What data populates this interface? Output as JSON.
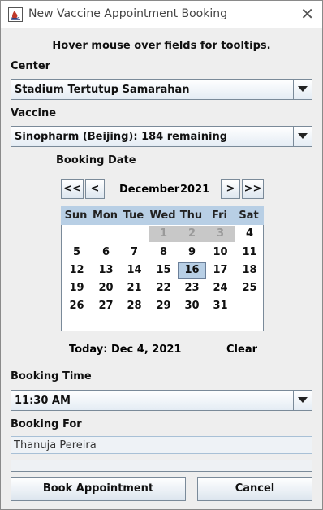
{
  "window": {
    "title": "New Vaccine Appointment Booking",
    "close_symbol": "✕"
  },
  "hint": "Hover mouse over fields for tooltips.",
  "center": {
    "label": "Center",
    "value": "Stadium Tertutup Samarahan"
  },
  "vaccine": {
    "label": "Vaccine",
    "value": "Sinopharm (Beijing): 184 remaining"
  },
  "booking_date": {
    "label": "Booking Date",
    "prev_year": "<<",
    "prev_month": "<",
    "next_month": ">",
    "next_year": ">>",
    "month": "December",
    "year": "2021",
    "weekdays": [
      "Sun",
      "Mon",
      "Tue",
      "Wed",
      "Thu",
      "Fri",
      "Sat"
    ],
    "weeks": [
      [
        "",
        "",
        "",
        "1",
        "2",
        "3",
        "4"
      ],
      [
        "5",
        "6",
        "7",
        "8",
        "9",
        "10",
        "11"
      ],
      [
        "12",
        "13",
        "14",
        "15",
        "16",
        "17",
        "18"
      ],
      [
        "19",
        "20",
        "21",
        "22",
        "23",
        "24",
        "25"
      ],
      [
        "26",
        "27",
        "28",
        "29",
        "30",
        "31",
        ""
      ]
    ],
    "greyed_days": [
      "1",
      "2",
      "3"
    ],
    "selected_day": "16",
    "today_text": "Today:  Dec 4, 2021",
    "clear_label": "Clear"
  },
  "booking_time": {
    "label": "Booking Time",
    "value": "11:30 AM"
  },
  "booking_for": {
    "label": "Booking For",
    "value": "Thanuja Pereira"
  },
  "progress": {
    "value": 0
  },
  "buttons": {
    "book": "Book Appointment",
    "cancel": "Cancel"
  },
  "colors": {
    "calendar_header": "#b8cfe5",
    "selected_day": "#b8cfe5",
    "greyed_day": "#c8c8c8"
  }
}
